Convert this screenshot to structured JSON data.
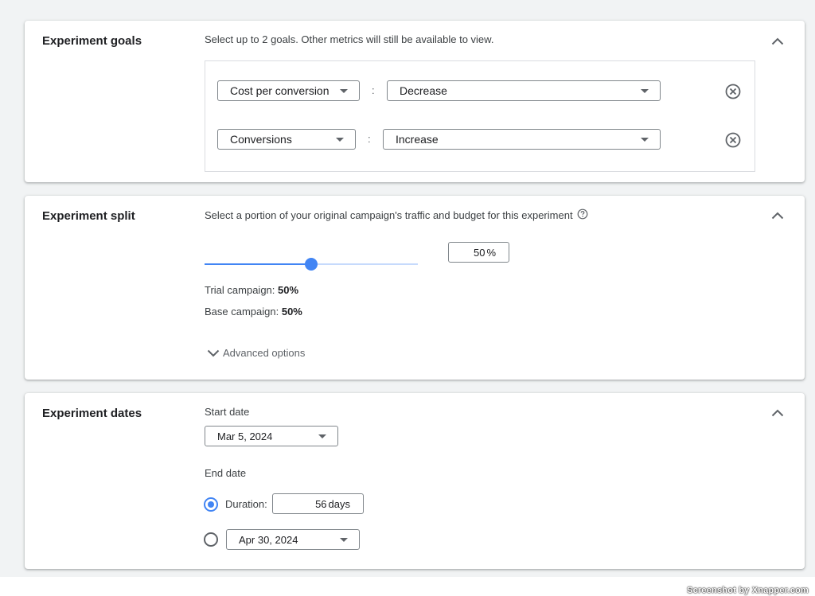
{
  "goals": {
    "title": "Experiment goals",
    "description": "Select up to 2 goals. Other metrics will still be available to view.",
    "rows": [
      {
        "metric": "Cost per conversion",
        "separator": ":",
        "direction": "Decrease"
      },
      {
        "metric": "Conversions",
        "separator": ":",
        "direction": "Increase"
      }
    ]
  },
  "split": {
    "title": "Experiment split",
    "description": "Select a portion of your original campaign's traffic and budget for this experiment",
    "slider_value": 50,
    "input_value": "50",
    "unit": "%",
    "trial_label": "Trial campaign: ",
    "trial_value": "50%",
    "base_label": "Base campaign: ",
    "base_value": "50%",
    "advanced_label": "Advanced options"
  },
  "dates": {
    "title": "Experiment dates",
    "start_label": "Start date",
    "start_value": "Mar 5, 2024",
    "end_label": "End date",
    "duration_label": "Duration:",
    "duration_value": "56",
    "duration_unit": "days",
    "end_value": "Apr 30, 2024"
  },
  "watermark": "Screenshot by Xnapper.com",
  "colors": {
    "accent": "#4285f4",
    "track": "#c6dafc",
    "background": "#f1f3f4"
  },
  "icons": [
    "chevron-up-icon",
    "caret-down-icon",
    "remove-circle-icon",
    "help-icon",
    "chevron-down-icon"
  ]
}
